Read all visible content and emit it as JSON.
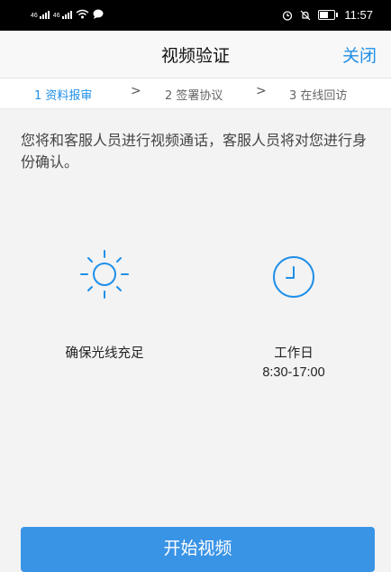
{
  "status_bar": {
    "network_label_1": "46",
    "network_label_2": "46",
    "time": "11:57"
  },
  "header": {
    "title": "视频验证",
    "close_label": "关闭"
  },
  "steps": [
    {
      "label": "1 资料报审",
      "active": true
    },
    {
      "label": "2 签署协议",
      "active": false
    },
    {
      "label": "3 在线回访",
      "active": false
    }
  ],
  "step_separator": ">",
  "description": "您将和客服人员进行视频通话，客服人员将对您进行身份确认。",
  "features": [
    {
      "icon": "sun-icon",
      "label": "确保光线充足"
    },
    {
      "icon": "clock-icon",
      "label": "工作日",
      "sub": "8:30-17:00"
    }
  ],
  "start_button": "开始视频",
  "colors": {
    "accent": "#1f8fe8",
    "button": "#3a94e6",
    "background": "#f3f3f3"
  }
}
